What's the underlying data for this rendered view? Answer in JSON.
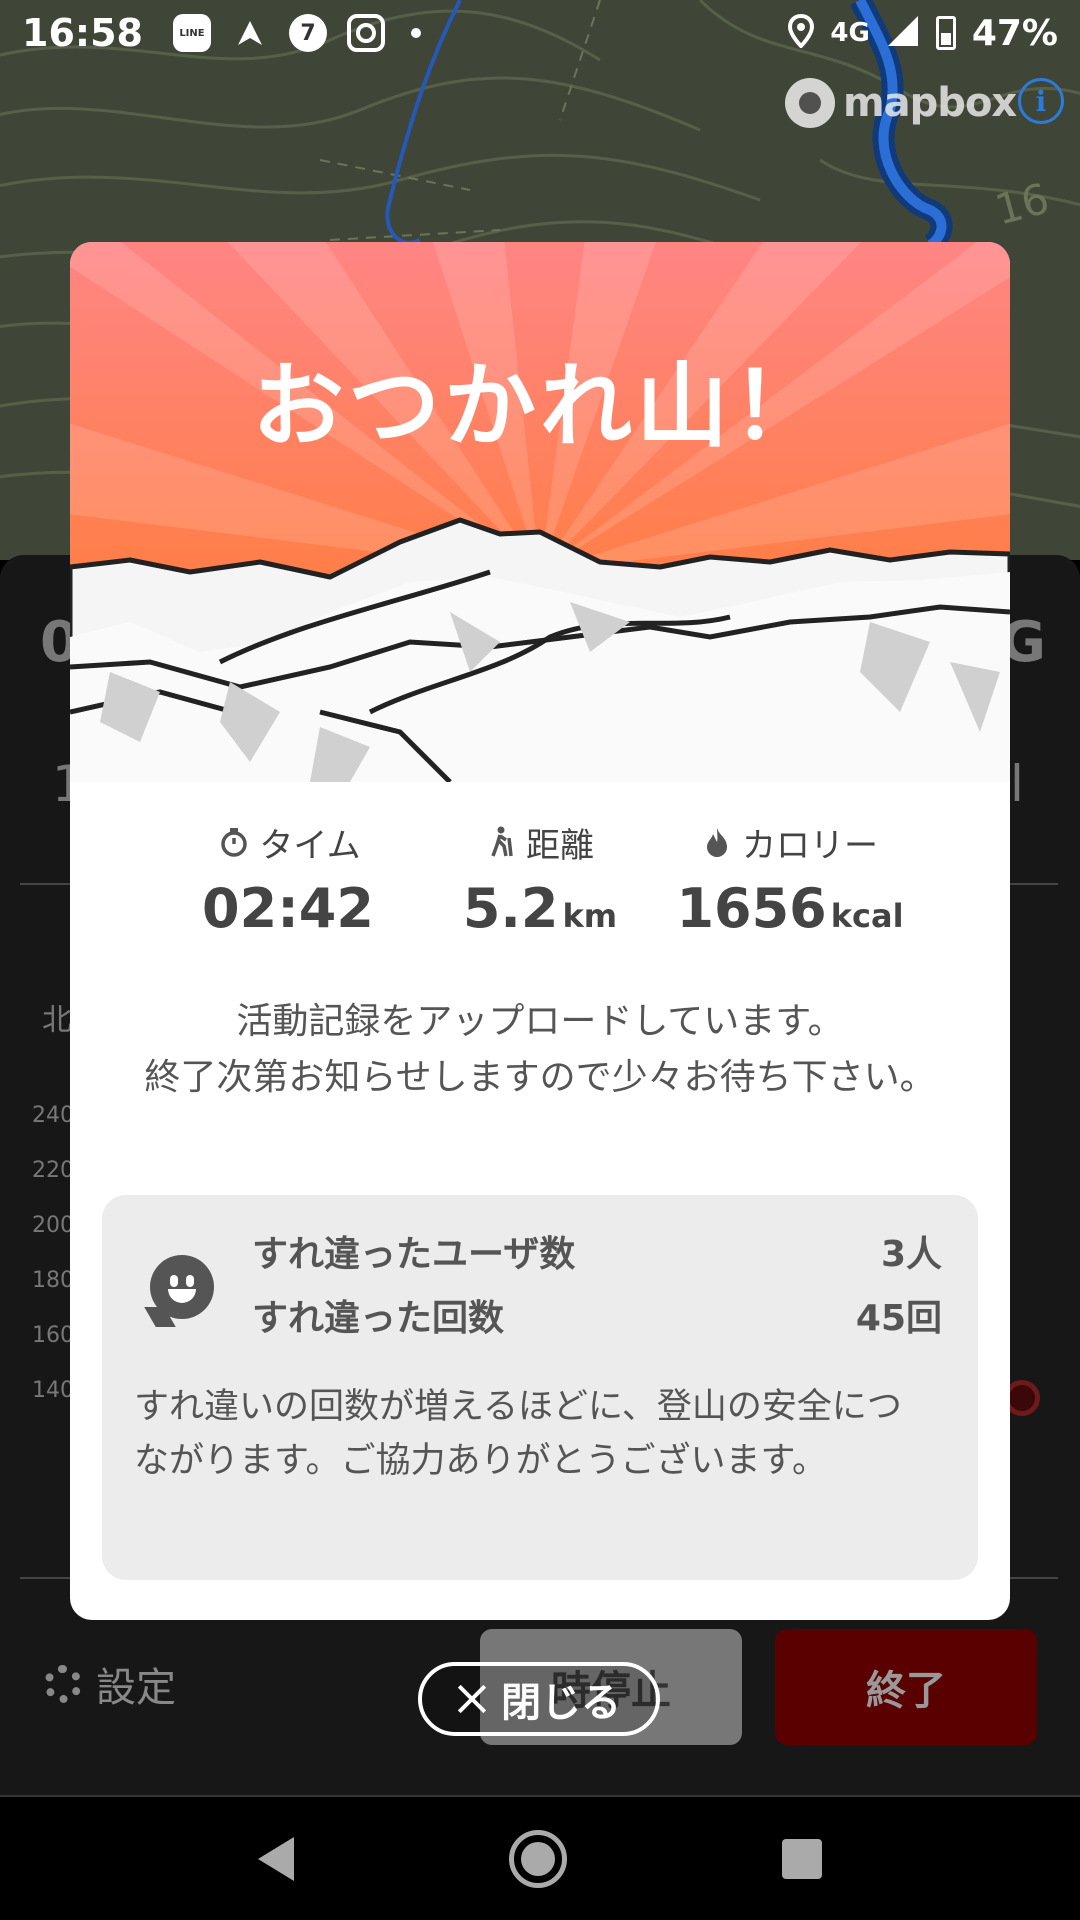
{
  "status_bar": {
    "time": "16:58",
    "network": "4G",
    "battery": "47%",
    "icons": [
      "line-icon",
      "navigation-icon",
      "seven-eleven-icon",
      "instagram-icon",
      "dot-icon",
      "location-icon",
      "signal-icon",
      "battery-icon"
    ]
  },
  "map": {
    "attribution_logo": "mapbox",
    "info_icon": "i"
  },
  "background_panel": {
    "row1_left": "0",
    "row1_right": "G",
    "row2_left": "1",
    "row2_right": "l",
    "north_label": "北",
    "axis_ticks": [
      "240",
      "220",
      "200",
      "180",
      "160",
      "140"
    ],
    "settings_label": "設定",
    "pause_button": "時停止",
    "end_button": "終了"
  },
  "modal": {
    "title": "おつかれ山！",
    "stats": [
      {
        "label": "タイム",
        "value": "02:42",
        "unit": "",
        "icon": "stopwatch-icon"
      },
      {
        "label": "距離",
        "value": "5.2",
        "unit": "km",
        "icon": "hiker-icon"
      },
      {
        "label": "カロリー",
        "value": "1656",
        "unit": "kcal",
        "icon": "flame-icon"
      }
    ],
    "upload_message_line1": "活動記録をアップロードしています。",
    "upload_message_line2": "終了次第お知らせしますので少々お待ち下さい。",
    "passing": {
      "users_label": "すれ違ったユーザ数",
      "users_value": "3人",
      "count_label": "すれ違った回数",
      "count_value": "45回",
      "note": "すれ違いの回数が増えるほどに、登山の安全につながります。ご協力ありがとうございます。"
    },
    "close_label": "閉じる"
  },
  "colors": {
    "hero_top": "#ff8a80",
    "hero_bottom": "#ff7a2e",
    "end_button": "#5a0000",
    "text_gray": "#444444"
  }
}
